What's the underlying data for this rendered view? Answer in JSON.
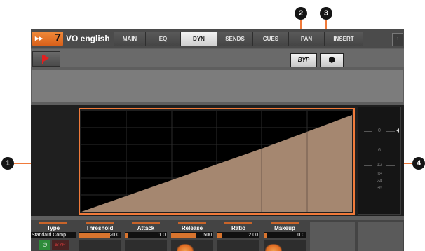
{
  "header": {
    "track_arrow": "▸▸",
    "track_number": "7",
    "track_name": "VO english",
    "tabs": [
      {
        "label": "MAIN",
        "active": false
      },
      {
        "label": "EQ",
        "active": false
      },
      {
        "label": "DYN",
        "active": true
      },
      {
        "label": "SENDS",
        "active": false
      },
      {
        "label": "CUES",
        "active": false
      },
      {
        "label": "PAN",
        "active": false
      },
      {
        "label": "INSERT",
        "active": false
      }
    ],
    "corner_icon": "meter-icon"
  },
  "toolbar": {
    "bypass_label": "BYP",
    "cube_icon": "cube-icon",
    "flag_icon": "flag-icon"
  },
  "meter": {
    "labels": [
      "0",
      "6",
      "12",
      "18",
      "24",
      "36"
    ]
  },
  "controls": [
    {
      "title": "Type",
      "value": "Standard Comp"
    },
    {
      "title": "Threshold",
      "value": "20.0",
      "fill": 0.75
    },
    {
      "title": "Attack",
      "value": "1.0",
      "fill": 0.05
    },
    {
      "title": "Release",
      "value": "500",
      "fill": 0.6
    },
    {
      "title": "Ratio",
      "value": "2.00",
      "fill": 0.1
    },
    {
      "title": "Makeup",
      "value": "0.0",
      "fill": 0.05
    }
  ],
  "type_control": {
    "power_icon": "power-icon",
    "byp_label": "BYP"
  },
  "callouts": [
    "1",
    "2",
    "3",
    "4"
  ],
  "colors": {
    "accent": "#f07a3a",
    "curve_fill": "#a58770",
    "active_tab": "#e8e8e8"
  }
}
